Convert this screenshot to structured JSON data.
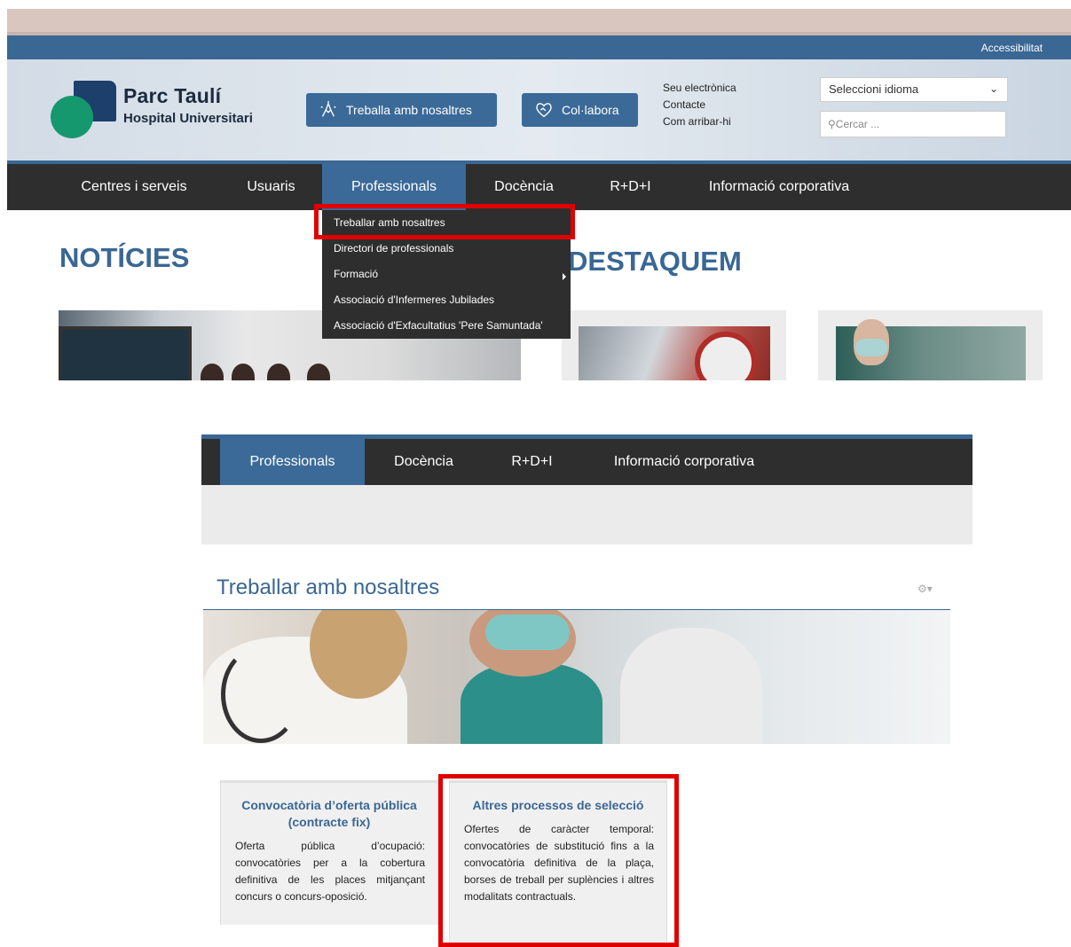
{
  "top": {
    "accessibility": "Accessibilitat",
    "logo": {
      "title": "Parc Taulí",
      "subtitle": "Hospital Universitari"
    },
    "buttons": {
      "work": "Treballa amb nosaltres",
      "colab": "Col·labora"
    },
    "links": [
      "Seu electrònica",
      "Contacte",
      "Com arribar-hi"
    ],
    "language_select": "Seleccioni idioma",
    "search_placeholder": "Cercar ...",
    "nav": [
      "Centres i serveis",
      "Usuaris",
      "Professionals",
      "Docència",
      "R+D+I",
      "Informació corporativa"
    ],
    "nav_active": "Professionals",
    "dropdown": [
      "Treballar amb nosaltres",
      "Directori de professionals",
      "Formació",
      "Associació d'Infermeres Jubilades",
      "Associació d'Exfacultatius 'Pere Samuntada'"
    ],
    "headings": {
      "news": "NOTÍCIES",
      "featured": "DESTAQUEM"
    }
  },
  "bottom": {
    "nav": [
      "Professionals",
      "Docència",
      "R+D+I",
      "Informació corporativa"
    ],
    "page_title": "Treballar amb nosaltres",
    "gear_icon": "⚙▾",
    "cards": [
      {
        "title": "Convocatòria d’oferta pública (contracte fix)",
        "body": "Oferta pública d’ocupació: convocatòries per a la cobertura definitiva de les places mitjançant concurs o concurs-oposició."
      },
      {
        "title": "Altres processos de selecció",
        "body": "Ofertes de caràcter temporal: convocatòries de substitució fins a la convocatòria definitiva de la plaça, borses de treball per suplències i altres modalitats contractuals."
      }
    ]
  },
  "colors": {
    "brand_blue": "#3a6794",
    "nav_dark": "#2e2e2e",
    "highlight_red": "#e00000",
    "logo_green": "#16986f"
  }
}
